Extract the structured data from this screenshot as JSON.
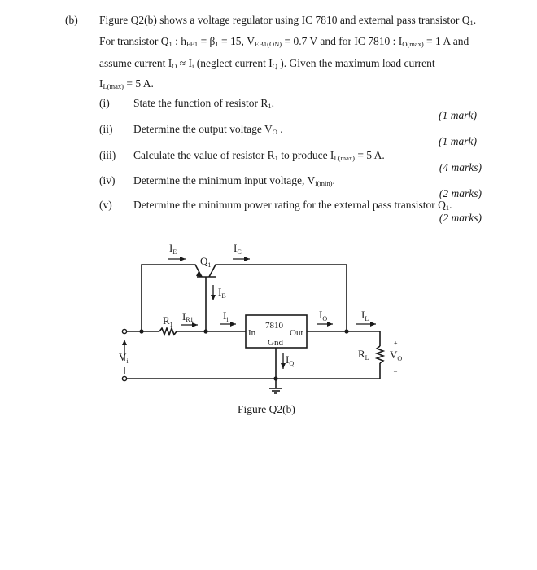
{
  "question": {
    "part_label": "(b)",
    "intro": {
      "line1": {
        "text": "Figure Q2(b) shows a voltage regulator using IC 7810  and external pass transistor  Q",
        "sub": "1",
        "end": "."
      },
      "line2": {
        "a": "For transistor Q",
        "a_sub": "1",
        "b": " :  h",
        "b_sub": "FE1",
        "c": " = β",
        "c_sub": "1",
        "d": " = 15,  V",
        "d_sub": "EB1(ON)",
        "e": " = 0.7 V  and for IC 7810 : I",
        "e_sub": "O(max)",
        "f": " = 1 A  and"
      },
      "line3": {
        "a": "assume current  I",
        "a_sub": "O",
        "b": " ≈ I",
        "b_sub": "i",
        "c": " (neglect current I",
        "c_sub": "Q",
        "d": " ).  Given the maximum load current"
      },
      "line4": {
        "a": "I",
        "a_sub": "L(max)",
        "b": " = 5 A."
      }
    },
    "subparts": [
      {
        "num": "(i)",
        "text": "State the function of resistor R",
        "sub": "1",
        "end": ".",
        "marks": "(1 mark)"
      },
      {
        "num": "(ii)",
        "text": "Determine the output voltage V",
        "sub": "O",
        "end": " .",
        "marks": "(1 mark)"
      },
      {
        "num": "(iii)",
        "text": "Calculate the value of resistor R",
        "sub": "1",
        "end": "  to produce  I",
        "sub2": "L(max)",
        "end2": " = 5 A.",
        "marks": "(4 marks)"
      },
      {
        "num": "(iv)",
        "text": "Determine the minimum input voltage, V",
        "sub": "i(min)",
        "end": ".",
        "marks": "(2 marks)"
      },
      {
        "num": "(v)",
        "text": "Determine the minimum power rating for the external pass transistor  Q",
        "sub": "1",
        "end": ".",
        "marks": "(2 marks)"
      }
    ]
  },
  "figure": {
    "caption": "Figure Q2(b)",
    "labels": {
      "IE": "I",
      "IE_sub": "E",
      "IC": "I",
      "IC_sub": "C",
      "Q1": "Q",
      "Q1_sub": "1",
      "IB": "I",
      "IB_sub": "B",
      "R1": "R",
      "R1_sub": "1",
      "IR1": "I",
      "IR1_sub": "R1",
      "Ii": "I",
      "Ii_sub": "i",
      "IO": "I",
      "IO_sub": "O",
      "IL": "I",
      "IL_sub": "L",
      "IQ": "I",
      "IQ_sub": "Q",
      "RL": "R",
      "RL_sub": "L",
      "VO": "V",
      "VO_sub": "O",
      "Vi": "V",
      "Vi_sub": "i",
      "plus": "+",
      "minus": "–",
      "ic_name": "7810",
      "ic_in": "In",
      "ic_out": "Out",
      "ic_gnd": "Gnd"
    }
  }
}
